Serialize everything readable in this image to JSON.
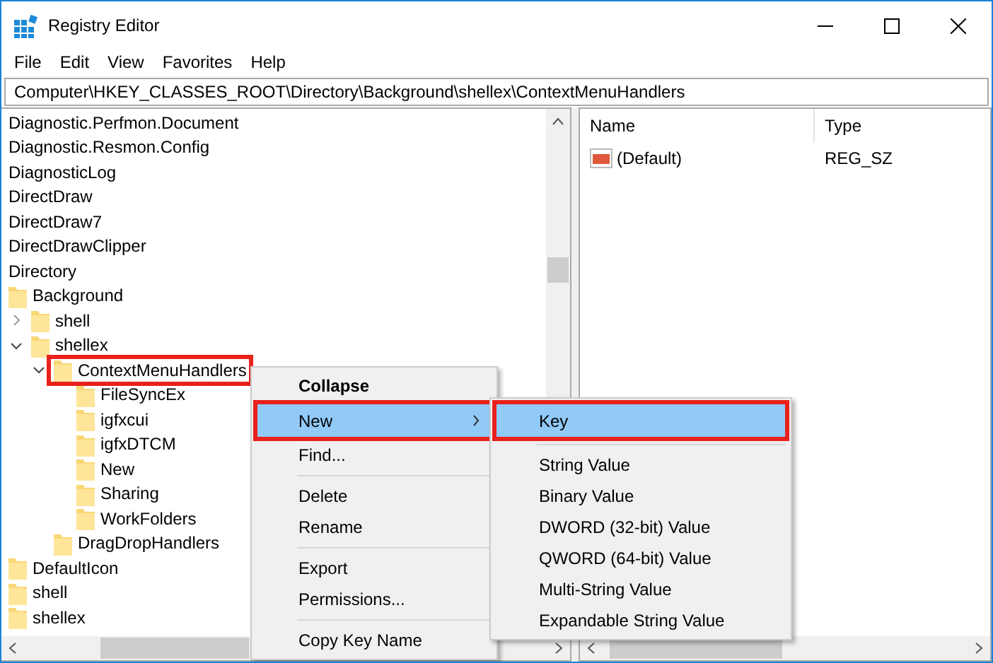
{
  "window": {
    "title": "Registry Editor"
  },
  "menu_bar": [
    "File",
    "Edit",
    "View",
    "Favorites",
    "Help"
  ],
  "address_bar": "Computer\\HKEY_CLASSES_ROOT\\Directory\\Background\\shellex\\ContextMenuHandlers",
  "tree": {
    "items": [
      {
        "label": "Diagnostic.Perfmon.Document",
        "selected": false
      },
      {
        "label": "Diagnostic.Resmon.Config",
        "selected": false
      },
      {
        "label": "DiagnosticLog",
        "selected": false
      },
      {
        "label": "DirectDraw",
        "selected": false
      },
      {
        "label": "DirectDraw7",
        "selected": false
      },
      {
        "label": "DirectDrawClipper",
        "selected": false
      },
      {
        "label": "Directory",
        "selected": false,
        "children": [
          {
            "label": "Background",
            "selected": false,
            "children": [
              {
                "label": "shell",
                "selected": false,
                "expanded": false
              },
              {
                "label": "shellex",
                "selected": false,
                "expanded": true,
                "children": [
                  {
                    "label": "ContextMenuHandlers",
                    "selected": true,
                    "expanded": true,
                    "children": [
                      {
                        "label": "FileSyncEx",
                        "selected": false
                      },
                      {
                        "label": "igfxcui",
                        "selected": false
                      },
                      {
                        "label": "igfxDTCM",
                        "selected": false
                      },
                      {
                        "label": "New",
                        "selected": false
                      },
                      {
                        "label": "Sharing",
                        "selected": false
                      },
                      {
                        "label": "WorkFolders",
                        "selected": false
                      }
                    ]
                  },
                  {
                    "label": "DragDropHandlers",
                    "selected": false
                  }
                ]
              }
            ]
          },
          {
            "label": "DefaultIcon",
            "selected": false
          },
          {
            "label": "shell",
            "selected": false
          },
          {
            "label": "shellex",
            "selected": false
          }
        ]
      }
    ]
  },
  "values": {
    "columns": [
      "Name",
      "Type"
    ],
    "rows": [
      {
        "name": "(Default)",
        "type": "REG_SZ"
      }
    ]
  },
  "context_menu": {
    "items": [
      {
        "kind": "item",
        "label": "Collapse",
        "default": true,
        "selected": false,
        "submenu": false
      },
      {
        "kind": "item",
        "label": "New",
        "default": false,
        "selected": true,
        "submenu": true
      },
      {
        "kind": "item",
        "label": "Find...",
        "default": false,
        "selected": false,
        "submenu": false
      },
      {
        "kind": "separator"
      },
      {
        "kind": "item",
        "label": "Delete",
        "default": false,
        "selected": false,
        "submenu": false
      },
      {
        "kind": "item",
        "label": "Rename",
        "default": false,
        "selected": false,
        "submenu": false
      },
      {
        "kind": "separator"
      },
      {
        "kind": "item",
        "label": "Export",
        "default": false,
        "selected": false,
        "submenu": false
      },
      {
        "kind": "item",
        "label": "Permissions...",
        "default": false,
        "selected": false,
        "submenu": false
      },
      {
        "kind": "separator"
      },
      {
        "kind": "item",
        "label": "Copy Key Name",
        "default": false,
        "selected": false,
        "submenu": false
      }
    ]
  },
  "submenu": {
    "items": [
      {
        "kind": "item",
        "label": "Key",
        "selected": true
      },
      {
        "kind": "separator"
      },
      {
        "kind": "item",
        "label": "String Value",
        "selected": false
      },
      {
        "kind": "item",
        "label": "Binary Value",
        "selected": false
      },
      {
        "kind": "item",
        "label": "DWORD (32-bit) Value",
        "selected": false
      },
      {
        "kind": "item",
        "label": "QWORD (64-bit) Value",
        "selected": false
      },
      {
        "kind": "item",
        "label": "Multi-String Value",
        "selected": false
      },
      {
        "kind": "item",
        "label": "Expandable String Value",
        "selected": false
      }
    ]
  }
}
